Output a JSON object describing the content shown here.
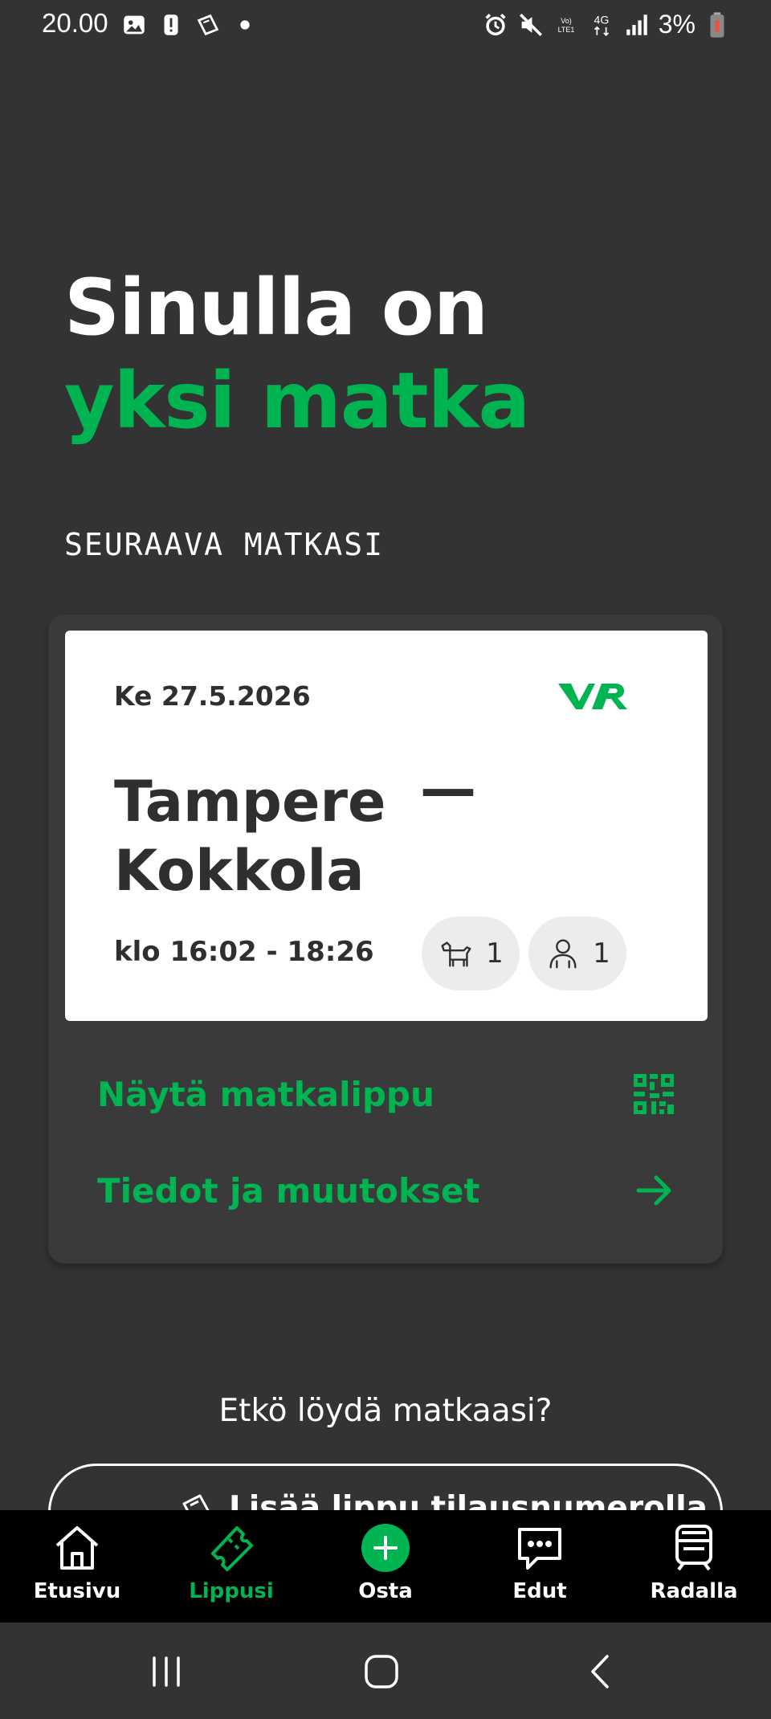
{
  "status_bar": {
    "time": "20.00",
    "battery": "3%",
    "left_icons": [
      "image-icon",
      "alert-icon",
      "tickets-notification-icon",
      "dot-icon"
    ],
    "right_icons": [
      "alarm-icon",
      "mute-icon",
      "volte-icon",
      "4g-icon",
      "signal-icon",
      "battery-icon"
    ]
  },
  "hero": {
    "line1": "Sinulla on",
    "line2": "yksi matka"
  },
  "section_label": "SEURAAVA MATKASI",
  "trip": {
    "date": "Ke 27.5.2026",
    "logo": "VR",
    "route_from": "Tampere",
    "route_dash": "—",
    "route_to": "Kokkola",
    "time": "klo 16:02 - 18:26",
    "pets": "1",
    "adults": "1",
    "show_ticket": "Näytä matkalippu",
    "details": "Tiedot ja muutokset"
  },
  "not_found_text": "Etkö löydä matkaasi?",
  "add_ticket_label": "Lisää lippu tilausnumerolla",
  "nav": {
    "home": "Etusivu",
    "tickets": "Lippusi",
    "buy": "Osta",
    "benefits": "Edut",
    "on_track": "Radalla"
  },
  "colors": {
    "accent": "#00b451",
    "background": "#333333",
    "card": "#ffffff"
  }
}
